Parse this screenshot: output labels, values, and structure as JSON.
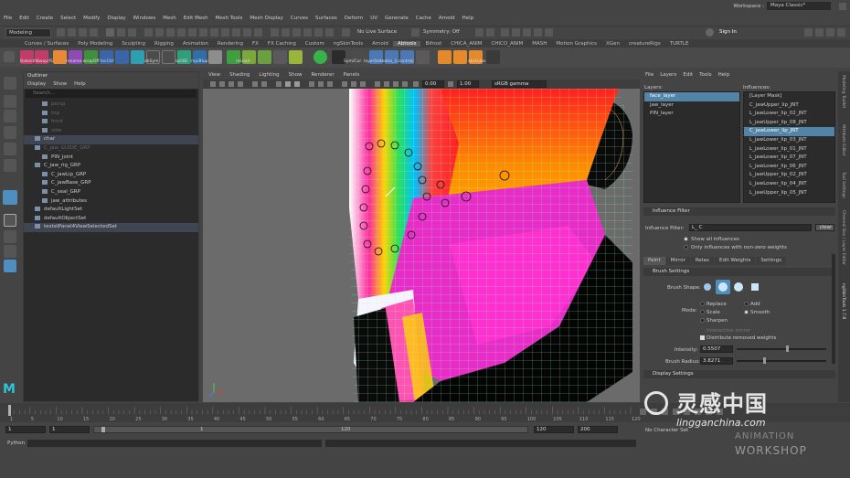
{
  "menus": [
    "File",
    "Edit",
    "Create",
    "Select",
    "Modify",
    "Display",
    "Windows",
    "Mesh",
    "Edit Mesh",
    "Mesh Tools",
    "Mesh Display",
    "Curves",
    "Surfaces",
    "Deform",
    "UV",
    "Generate",
    "Cache",
    "Arnold",
    "Help"
  ],
  "workspace": {
    "label": "Workspace :",
    "value": "Maya Classic*"
  },
  "status": {
    "mode": "Modeling",
    "live": "No Live Surface",
    "symmetry": "Symmetry: Off",
    "signin": "Sign In"
  },
  "shelf_tabs": [
    "Curves / Surfaces",
    "Poly Modeling",
    "Sculpting",
    "Rigging",
    "Animation",
    "Rendering",
    "FX",
    "FX Caching",
    "Custom",
    "ngSkinTools",
    "Arnold",
    "Abtools",
    "Bifrost",
    "CHICA_ANIM",
    "CHICO_ANIM",
    "MASH",
    "Motion Graphics",
    "XGen",
    "creatureRigs",
    "TURTLE"
  ],
  "shelf_active": "Abtools",
  "shelf_labels": [
    "Bakeinfo",
    "Swap/IS",
    "rename.wrapOff",
    "locCtrl",
    "abSym",
    "splitEl",
    "mpiBlup",
    "reLoad",
    "Sym/Cur",
    "layerSer",
    "toolss_1.controlj",
    "abstutos"
  ],
  "outliner": {
    "title": "Outliner",
    "menu": [
      "Display",
      "Show",
      "Help"
    ],
    "search": "Search...",
    "rows": [
      {
        "label": "persp",
        "dim": true,
        "indent": 1
      },
      {
        "label": "top",
        "dim": true,
        "indent": 1
      },
      {
        "label": "front",
        "dim": true,
        "indent": 1
      },
      {
        "label": "side",
        "dim": true,
        "indent": 1
      },
      {
        "label": "char",
        "dim": false,
        "indent": 0,
        "hl": true
      },
      {
        "label": "C_jaw_GUIDE_GRP",
        "dim": true,
        "indent": 0
      },
      {
        "label": "PIN_joint",
        "dim": false,
        "indent": 1
      },
      {
        "label": "C_jaw_rig_GRP",
        "dim": false,
        "indent": 0
      },
      {
        "label": "C_jawLip_GRP",
        "dim": false,
        "indent": 1
      },
      {
        "label": "C_jawBase_GRP",
        "dim": false,
        "indent": 1
      },
      {
        "label": "C_seal_GRP",
        "dim": false,
        "indent": 1
      },
      {
        "label": "jaw_attributes",
        "dim": false,
        "indent": 1
      },
      {
        "label": "defaultLightSet",
        "dim": false,
        "indent": 0
      },
      {
        "label": "defaultObjectSet",
        "dim": false,
        "indent": 0
      },
      {
        "label": "textelPanel4ViewSelectedSet",
        "dim": false,
        "indent": 0,
        "hl": true
      }
    ]
  },
  "viewport": {
    "menu": [
      "View",
      "Shading",
      "Lighting",
      "Show",
      "Renderer",
      "Panels"
    ],
    "val1": "0.00",
    "val2": "1.00",
    "colorspace": "sRGB gamma"
  },
  "paint": {
    "top_menu": [
      "File",
      "Layers",
      "Edit",
      "Tools",
      "Help"
    ],
    "layers_label": "Layers:",
    "layers": [
      "face_layer",
      "jaw_layer",
      "PIN_layer"
    ],
    "influences_label": "Influences:",
    "influences": [
      "[Layer Mask]",
      "C_jawUpper_lip_JNT",
      "L_jawLower_lip_02_JNT",
      "L_jawUpper_lip_08_JNT",
      "C_jawLower_lip_JNT",
      "L_jawLower_lip_03_JNT",
      "L_jawLower_lip_01_JNT",
      "L_jawLower_lip_07_JNT",
      "L_jawLower_lip_06_JNT",
      "L_jawUpper_lip_02_JNT",
      "L_jawLower_lip_04_JNT",
      "L_jawUpper_lip_05_JNT"
    ],
    "influences_selected": 4,
    "filter_section": "Influence Filter",
    "filter_label": "Influence Filter:",
    "filter_value": "L_ C",
    "clear": "clear",
    "show_all": "Show all influences",
    "only_nonzero": "Only influences with non-zero weights",
    "tabs": [
      "Paint",
      "Mirror",
      "Relax",
      "Edit Weights",
      "Settings"
    ],
    "brush_section": "Brush Settings",
    "brush_shape": "Brush Shape:",
    "mode_label": "Mode:",
    "modes": [
      "Replace",
      "Add",
      "Scale",
      "Smooth",
      "Sharpen"
    ],
    "interactive": "Interactive mirror",
    "distribute": "Distribute removed weights",
    "intensity_label": "Intensity:",
    "intensity": "0.5507",
    "intensity_frac": 0.55,
    "radius_label": "Brush Radius:",
    "radius": "3.8271",
    "radius_frac": 0.3,
    "display_section": "Display Settings",
    "side_tabs": [
      "Modeling Toolkit",
      "Attribute Editor",
      "Tool Settings",
      "Channel Box / Layer Editor",
      "ngSkinTools 1.7.8"
    ]
  },
  "timeline": {
    "ticks": [
      "1",
      "5",
      "10",
      "15",
      "20",
      "25",
      "30",
      "35",
      "40",
      "45",
      "50",
      "55",
      "60",
      "65",
      "70",
      "75",
      "80",
      "85",
      "90",
      "95",
      "100",
      "105",
      "110",
      "115",
      "120"
    ],
    "current": "1"
  },
  "range": {
    "start": "1",
    "inner_start": "1",
    "inner_end": "120",
    "end": "120",
    "max": "200",
    "character": "No Character Set"
  },
  "cmd": {
    "lang": "Python"
  },
  "watermark": {
    "cn": "灵感中国",
    "site": "lingganchina.com",
    "ws1": "ANIMATION",
    "ws2": "WORKSHOP"
  }
}
